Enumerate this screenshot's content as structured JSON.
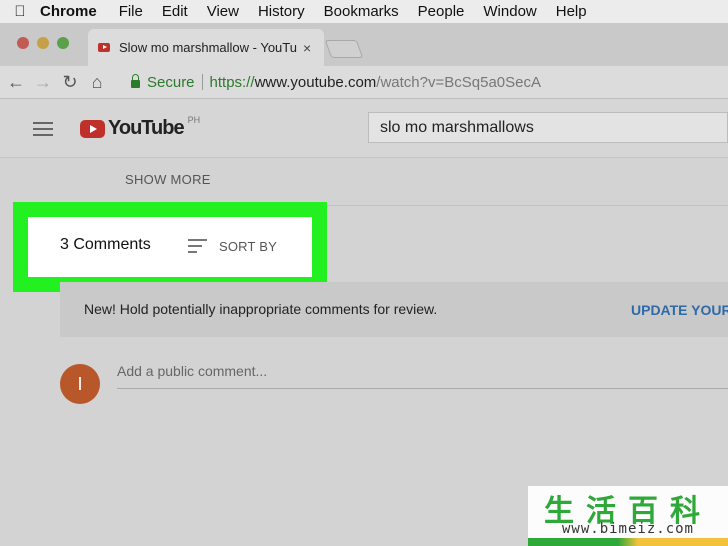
{
  "menubar": {
    "apple_icon": "apple-icon",
    "items": [
      "Chrome",
      "File",
      "Edit",
      "View",
      "History",
      "Bookmarks",
      "People",
      "Window",
      "Help"
    ]
  },
  "tab": {
    "title": "Slow mo marshmallow - YouTube",
    "close": "×"
  },
  "toolbar": {
    "back": "←",
    "forward": "→",
    "reload": "↻",
    "home": "⌂",
    "secure_label": "Secure",
    "url_scheme": "https://",
    "url_host": "www.youtube.com",
    "url_path": "/watch?v=BcSq5a0SecA"
  },
  "youtube": {
    "logo_text": "YouTube",
    "region": "PH",
    "search_value": "slo mo marshmallows",
    "show_more": "SHOW MORE",
    "comments_count": "3 Comments",
    "sort_by": "SORT BY",
    "notice_text": "New! Hold potentially inappropriate comments for review.",
    "notice_link": "UPDATE YOUR",
    "avatar_initial": "I",
    "comment_placeholder": "Add a public comment..."
  },
  "watermark": {
    "chinese": "生活百科",
    "url": "www.bimeiz.com"
  },
  "colors": {
    "highlight": "#22f020",
    "youtube_red": "#c0302a",
    "link_blue": "#2f6aa8",
    "secure_green": "#2c7a2c",
    "avatar": "#b8572a"
  }
}
